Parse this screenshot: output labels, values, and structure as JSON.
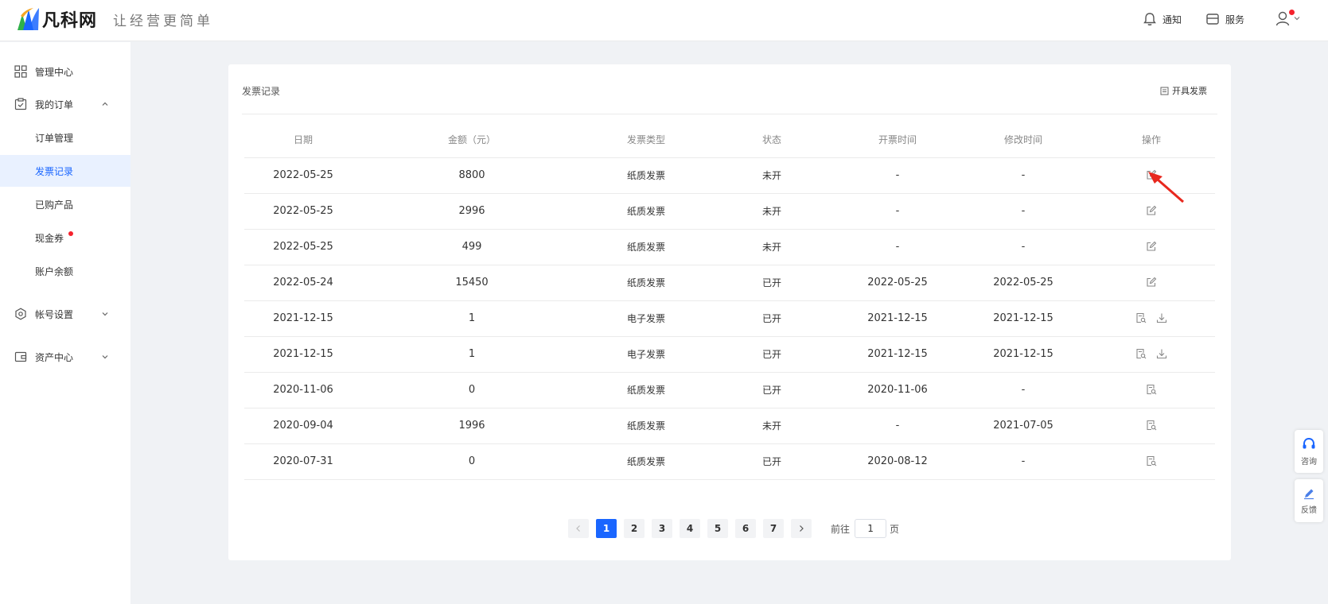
{
  "header": {
    "logo_name": "凡科网",
    "slogan": "让经营更简单",
    "notify_label": "通知",
    "service_label": "服务"
  },
  "sidebar": {
    "items": [
      {
        "label": "管理中心",
        "icon": "grid-icon"
      },
      {
        "label": "我的订单",
        "icon": "order-icon",
        "expanded": true
      },
      {
        "label": "订单管理"
      },
      {
        "label": "发票记录",
        "active": true
      },
      {
        "label": "已购产品"
      },
      {
        "label": "现金券",
        "badge": true
      },
      {
        "label": "账户余额"
      },
      {
        "label": "帐号设置",
        "icon": "settings-icon"
      },
      {
        "label": "资产中心",
        "icon": "wallet-icon"
      }
    ]
  },
  "card": {
    "title": "发票记录",
    "issue_button": "开具发票"
  },
  "table": {
    "headers": [
      "日期",
      "金额（元）",
      "发票类型",
      "状态",
      "开票时间",
      "修改时间",
      "操作"
    ],
    "rows": [
      {
        "date": "2022-05-25",
        "amount": "8800",
        "type": "纸质发票",
        "status": "未开",
        "issued": "-",
        "modified": "-",
        "ops": [
          "edit-icon"
        ]
      },
      {
        "date": "2022-05-25",
        "amount": "2996",
        "type": "纸质发票",
        "status": "未开",
        "issued": "-",
        "modified": "-",
        "ops": [
          "edit-icon"
        ]
      },
      {
        "date": "2022-05-25",
        "amount": "499",
        "type": "纸质发票",
        "status": "未开",
        "issued": "-",
        "modified": "-",
        "ops": [
          "edit-icon"
        ]
      },
      {
        "date": "2022-05-24",
        "amount": "15450",
        "type": "纸质发票",
        "status": "已开",
        "issued": "2022-05-25",
        "modified": "2022-05-25",
        "ops": [
          "edit-icon"
        ]
      },
      {
        "date": "2021-12-15",
        "amount": "1",
        "type": "电子发票",
        "status": "已开",
        "issued": "2021-12-15",
        "modified": "2021-12-15",
        "ops": [
          "view-icon",
          "download-icon"
        ]
      },
      {
        "date": "2021-12-15",
        "amount": "1",
        "type": "电子发票",
        "status": "已开",
        "issued": "2021-12-15",
        "modified": "2021-12-15",
        "ops": [
          "view-icon",
          "download-icon"
        ]
      },
      {
        "date": "2020-11-06",
        "amount": "0",
        "type": "纸质发票",
        "status": "已开",
        "issued": "2020-11-06",
        "modified": "-",
        "ops": [
          "view-icon"
        ]
      },
      {
        "date": "2020-09-04",
        "amount": "1996",
        "type": "纸质发票",
        "status": "未开",
        "issued": "-",
        "modified": "2021-07-05",
        "ops": [
          "view-icon"
        ]
      },
      {
        "date": "2020-07-31",
        "amount": "0",
        "type": "纸质发票",
        "status": "已开",
        "issued": "2020-08-12",
        "modified": "-",
        "ops": [
          "view-icon"
        ]
      }
    ]
  },
  "pagination": {
    "pages": [
      "1",
      "2",
      "3",
      "4",
      "5",
      "6",
      "7"
    ],
    "current": "1",
    "goto_prefix": "前往",
    "goto_value": "1",
    "goto_suffix": "页"
  },
  "float": {
    "consult_label": "咨询",
    "feedback_label": "反馈"
  },
  "colors": {
    "accent": "#1a66ff",
    "badge": "#f5222d",
    "arrow": "#e8281e"
  }
}
